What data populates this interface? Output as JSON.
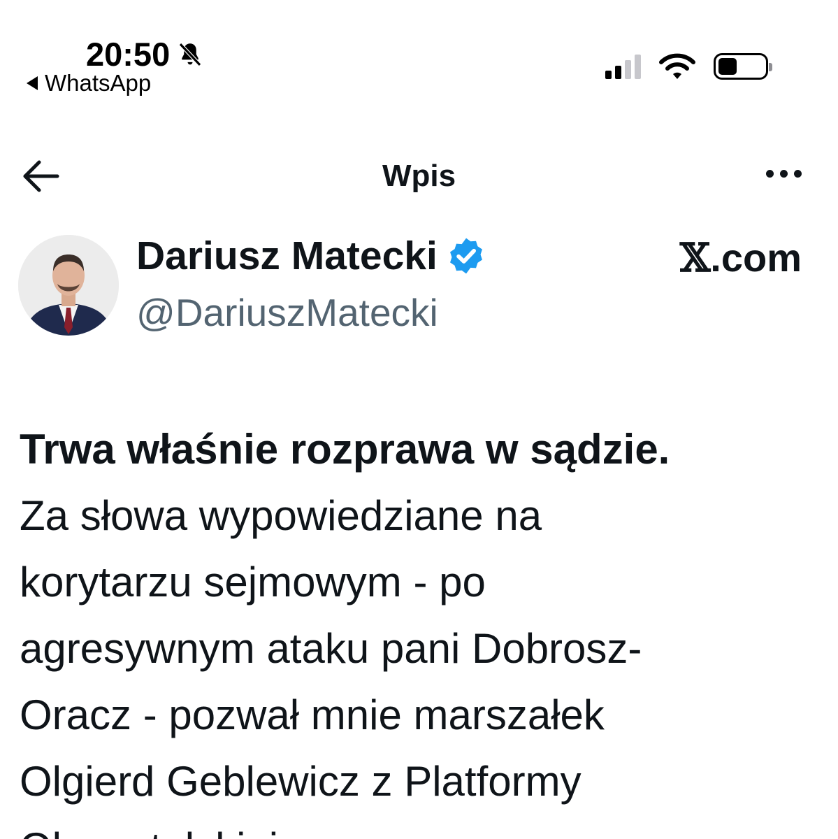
{
  "status_bar": {
    "time": "20:50",
    "back_app": "WhatsApp"
  },
  "nav": {
    "title": "Wpis"
  },
  "profile": {
    "display_name": "Dariusz Matecki",
    "handle": "@DariuszMatecki",
    "site_mark": "𝕏",
    "site_suffix": ".com"
  },
  "tweet": {
    "headline": "Trwa właśnie rozprawa w sądzie.",
    "lines": [
      "Za słowa wypowiedziane na",
      "korytarzu sejmowym - po",
      "agresywnym ataku pani Dobrosz-",
      "Oracz - pozwał mnie marszałek",
      "Olgierd Geblewicz z Platformy",
      "Obywatelskiej"
    ]
  },
  "colors": {
    "text_primary": "#0f1419",
    "text_secondary": "#536471",
    "verified_blue": "#1d9bf0"
  }
}
